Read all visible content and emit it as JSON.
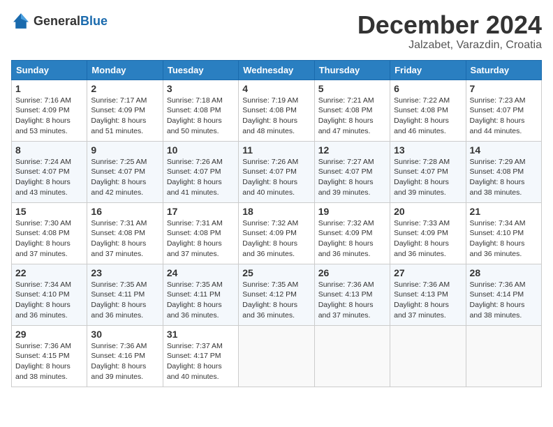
{
  "header": {
    "logo": {
      "text_general": "General",
      "text_blue": "Blue"
    },
    "title": "December 2024",
    "location": "Jalzabet, Varazdin, Croatia"
  },
  "calendar": {
    "days_of_week": [
      "Sunday",
      "Monday",
      "Tuesday",
      "Wednesday",
      "Thursday",
      "Friday",
      "Saturday"
    ],
    "weeks": [
      [
        {
          "day": "1",
          "sunrise": "Sunrise: 7:16 AM",
          "sunset": "Sunset: 4:09 PM",
          "daylight": "Daylight: 8 hours and 53 minutes."
        },
        {
          "day": "2",
          "sunrise": "Sunrise: 7:17 AM",
          "sunset": "Sunset: 4:09 PM",
          "daylight": "Daylight: 8 hours and 51 minutes."
        },
        {
          "day": "3",
          "sunrise": "Sunrise: 7:18 AM",
          "sunset": "Sunset: 4:08 PM",
          "daylight": "Daylight: 8 hours and 50 minutes."
        },
        {
          "day": "4",
          "sunrise": "Sunrise: 7:19 AM",
          "sunset": "Sunset: 4:08 PM",
          "daylight": "Daylight: 8 hours and 48 minutes."
        },
        {
          "day": "5",
          "sunrise": "Sunrise: 7:21 AM",
          "sunset": "Sunset: 4:08 PM",
          "daylight": "Daylight: 8 hours and 47 minutes."
        },
        {
          "day": "6",
          "sunrise": "Sunrise: 7:22 AM",
          "sunset": "Sunset: 4:08 PM",
          "daylight": "Daylight: 8 hours and 46 minutes."
        },
        {
          "day": "7",
          "sunrise": "Sunrise: 7:23 AM",
          "sunset": "Sunset: 4:07 PM",
          "daylight": "Daylight: 8 hours and 44 minutes."
        }
      ],
      [
        {
          "day": "8",
          "sunrise": "Sunrise: 7:24 AM",
          "sunset": "Sunset: 4:07 PM",
          "daylight": "Daylight: 8 hours and 43 minutes."
        },
        {
          "day": "9",
          "sunrise": "Sunrise: 7:25 AM",
          "sunset": "Sunset: 4:07 PM",
          "daylight": "Daylight: 8 hours and 42 minutes."
        },
        {
          "day": "10",
          "sunrise": "Sunrise: 7:26 AM",
          "sunset": "Sunset: 4:07 PM",
          "daylight": "Daylight: 8 hours and 41 minutes."
        },
        {
          "day": "11",
          "sunrise": "Sunrise: 7:26 AM",
          "sunset": "Sunset: 4:07 PM",
          "daylight": "Daylight: 8 hours and 40 minutes."
        },
        {
          "day": "12",
          "sunrise": "Sunrise: 7:27 AM",
          "sunset": "Sunset: 4:07 PM",
          "daylight": "Daylight: 8 hours and 39 minutes."
        },
        {
          "day": "13",
          "sunrise": "Sunrise: 7:28 AM",
          "sunset": "Sunset: 4:07 PM",
          "daylight": "Daylight: 8 hours and 39 minutes."
        },
        {
          "day": "14",
          "sunrise": "Sunrise: 7:29 AM",
          "sunset": "Sunset: 4:08 PM",
          "daylight": "Daylight: 8 hours and 38 minutes."
        }
      ],
      [
        {
          "day": "15",
          "sunrise": "Sunrise: 7:30 AM",
          "sunset": "Sunset: 4:08 PM",
          "daylight": "Daylight: 8 hours and 37 minutes."
        },
        {
          "day": "16",
          "sunrise": "Sunrise: 7:31 AM",
          "sunset": "Sunset: 4:08 PM",
          "daylight": "Daylight: 8 hours and 37 minutes."
        },
        {
          "day": "17",
          "sunrise": "Sunrise: 7:31 AM",
          "sunset": "Sunset: 4:08 PM",
          "daylight": "Daylight: 8 hours and 37 minutes."
        },
        {
          "day": "18",
          "sunrise": "Sunrise: 7:32 AM",
          "sunset": "Sunset: 4:09 PM",
          "daylight": "Daylight: 8 hours and 36 minutes."
        },
        {
          "day": "19",
          "sunrise": "Sunrise: 7:32 AM",
          "sunset": "Sunset: 4:09 PM",
          "daylight": "Daylight: 8 hours and 36 minutes."
        },
        {
          "day": "20",
          "sunrise": "Sunrise: 7:33 AM",
          "sunset": "Sunset: 4:09 PM",
          "daylight": "Daylight: 8 hours and 36 minutes."
        },
        {
          "day": "21",
          "sunrise": "Sunrise: 7:34 AM",
          "sunset": "Sunset: 4:10 PM",
          "daylight": "Daylight: 8 hours and 36 minutes."
        }
      ],
      [
        {
          "day": "22",
          "sunrise": "Sunrise: 7:34 AM",
          "sunset": "Sunset: 4:10 PM",
          "daylight": "Daylight: 8 hours and 36 minutes."
        },
        {
          "day": "23",
          "sunrise": "Sunrise: 7:35 AM",
          "sunset": "Sunset: 4:11 PM",
          "daylight": "Daylight: 8 hours and 36 minutes."
        },
        {
          "day": "24",
          "sunrise": "Sunrise: 7:35 AM",
          "sunset": "Sunset: 4:11 PM",
          "daylight": "Daylight: 8 hours and 36 minutes."
        },
        {
          "day": "25",
          "sunrise": "Sunrise: 7:35 AM",
          "sunset": "Sunset: 4:12 PM",
          "daylight": "Daylight: 8 hours and 36 minutes."
        },
        {
          "day": "26",
          "sunrise": "Sunrise: 7:36 AM",
          "sunset": "Sunset: 4:13 PM",
          "daylight": "Daylight: 8 hours and 37 minutes."
        },
        {
          "day": "27",
          "sunrise": "Sunrise: 7:36 AM",
          "sunset": "Sunset: 4:13 PM",
          "daylight": "Daylight: 8 hours and 37 minutes."
        },
        {
          "day": "28",
          "sunrise": "Sunrise: 7:36 AM",
          "sunset": "Sunset: 4:14 PM",
          "daylight": "Daylight: 8 hours and 38 minutes."
        }
      ],
      [
        {
          "day": "29",
          "sunrise": "Sunrise: 7:36 AM",
          "sunset": "Sunset: 4:15 PM",
          "daylight": "Daylight: 8 hours and 38 minutes."
        },
        {
          "day": "30",
          "sunrise": "Sunrise: 7:36 AM",
          "sunset": "Sunset: 4:16 PM",
          "daylight": "Daylight: 8 hours and 39 minutes."
        },
        {
          "day": "31",
          "sunrise": "Sunrise: 7:37 AM",
          "sunset": "Sunset: 4:17 PM",
          "daylight": "Daylight: 8 hours and 40 minutes."
        },
        null,
        null,
        null,
        null
      ]
    ]
  }
}
